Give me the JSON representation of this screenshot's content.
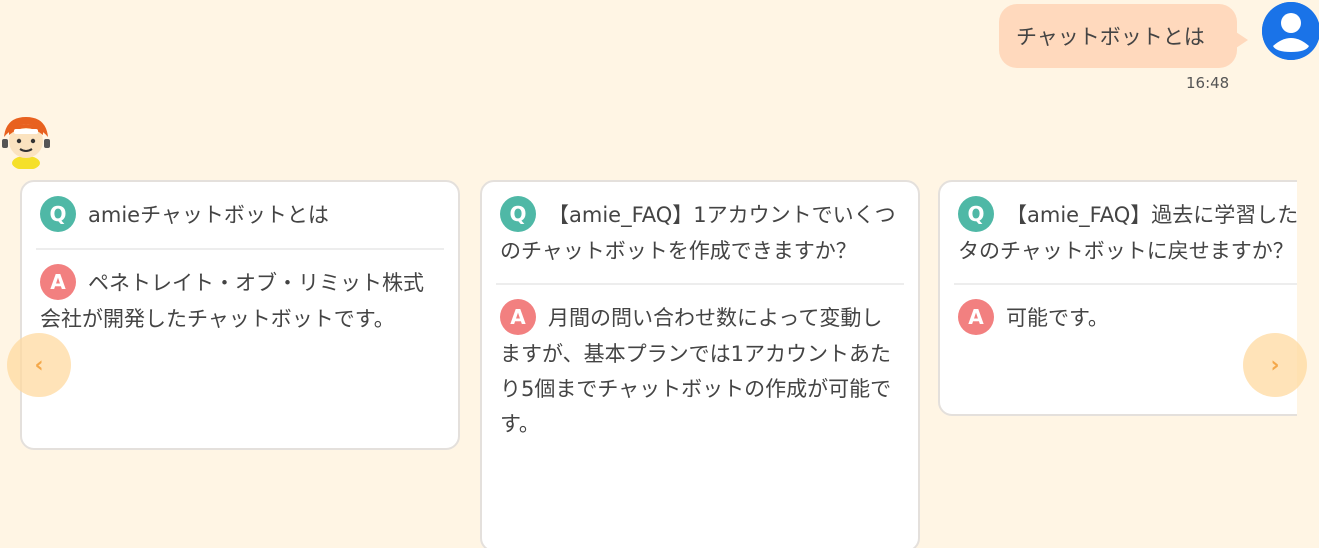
{
  "user_message": {
    "text": "チャットボットとは",
    "time": "16:48"
  },
  "icons": {
    "user_avatar": "user-avatar-icon",
    "bot_avatar": "bot-mascot-icon",
    "prev": "chevron-left-icon",
    "next": "chevron-right-icon"
  },
  "colors": {
    "background": "#fff5e4",
    "user_bubble": "#ffd9bd",
    "user_avatar": "#1a73e8",
    "q_badge": "#4fb8a6",
    "a_badge": "#f28080",
    "nav_arrow": "#f4a84a"
  },
  "carousel": {
    "prev_label": "‹",
    "next_label": "›",
    "cards": [
      {
        "q_badge": "Q",
        "question": "amieチャットボットとは",
        "a_badge": "A",
        "answer": "ペネトレイト・オブ・リミット株式会社が開発したチャットボットです。"
      },
      {
        "q_badge": "Q",
        "question": "【amie_FAQ】1アカウントでいくつのチャットボットを作成できますか？",
        "a_badge": "A",
        "answer": "月間の問い合わせ数によって変動しますが、基本プランでは1アカウントあたり5個までチャットボットの作成が可能です。"
      },
      {
        "q_badge": "Q",
        "question": "【amie_FAQ】過去に学習したデータのチャットボットに戻せますか？",
        "a_badge": "A",
        "answer": "可能です。"
      }
    ]
  }
}
